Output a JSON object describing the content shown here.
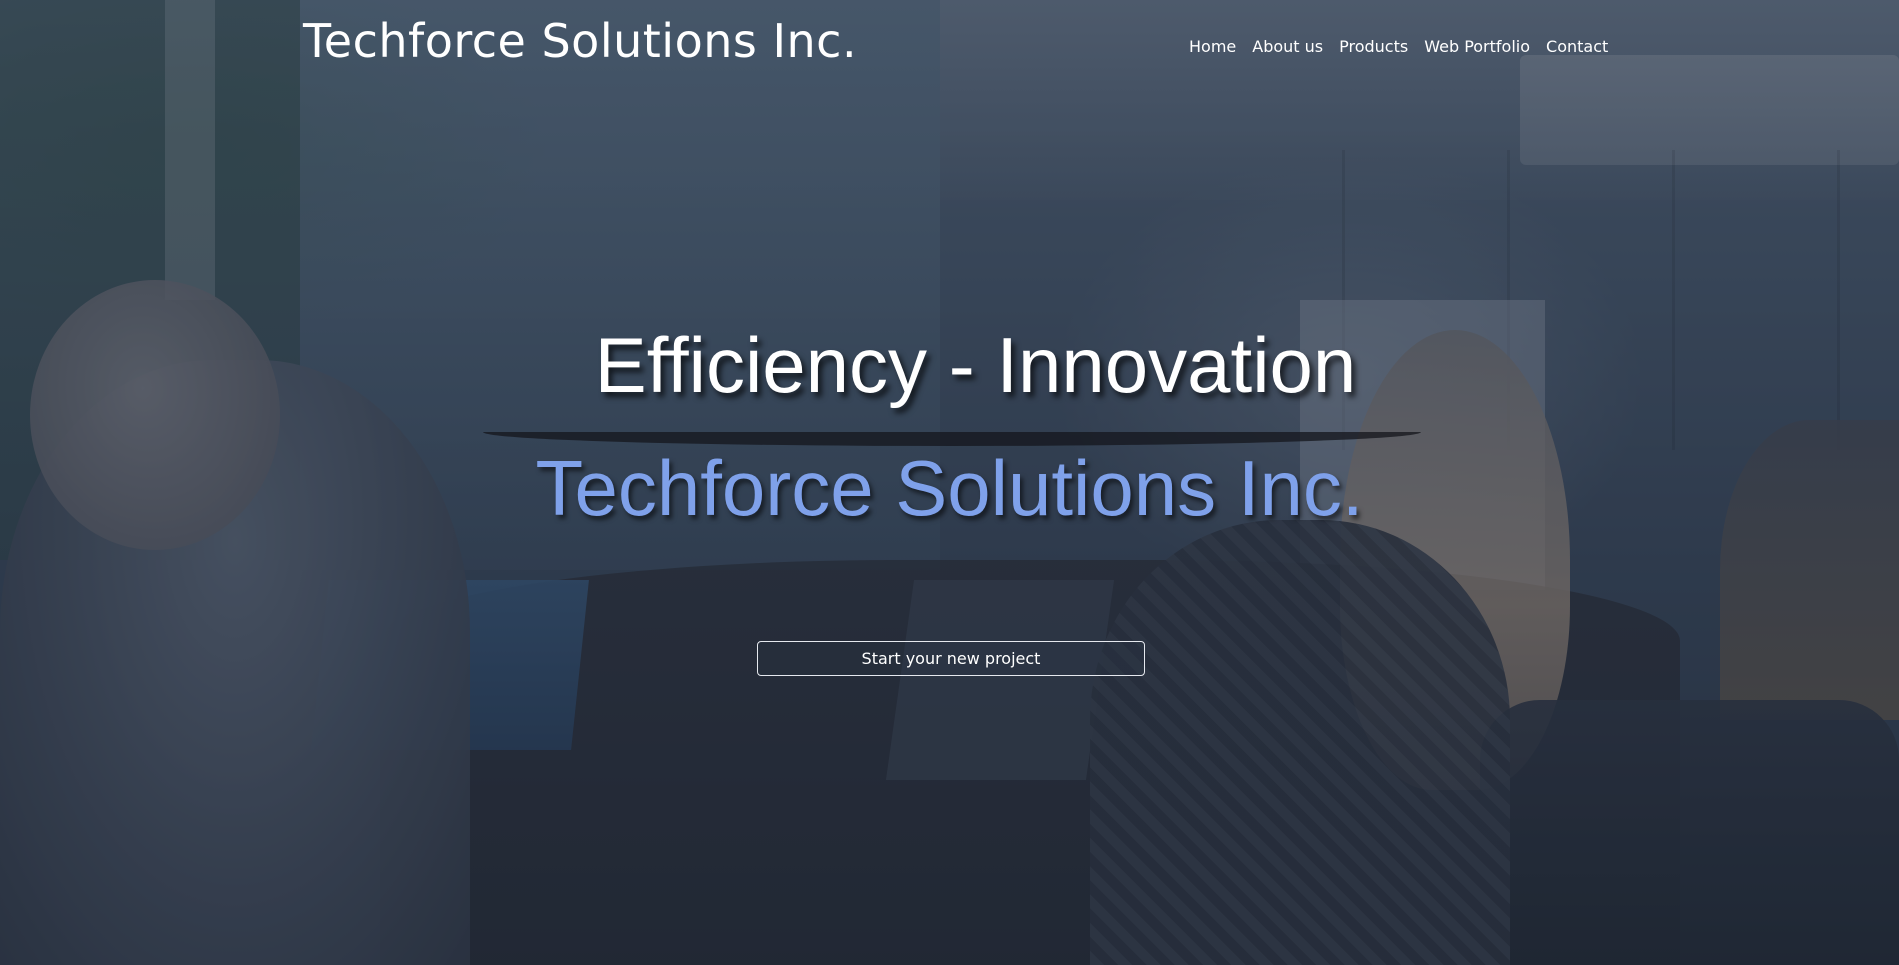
{
  "header": {
    "brand": "Techforce Solutions Inc.",
    "nav": [
      {
        "label": "Home"
      },
      {
        "label": "About us"
      },
      {
        "label": "Products"
      },
      {
        "label": "Web Portfolio"
      },
      {
        "label": "Contact"
      }
    ]
  },
  "hero": {
    "headline": "Efficiency - Innovation",
    "subheadline": "Techforce Solutions Inc.",
    "cta_label": "Start your new project",
    "background": "meeting-room-photo"
  },
  "colors": {
    "accent": "#7fa1ea",
    "text": "#ffffff",
    "overlay": "#1e2a3c"
  }
}
